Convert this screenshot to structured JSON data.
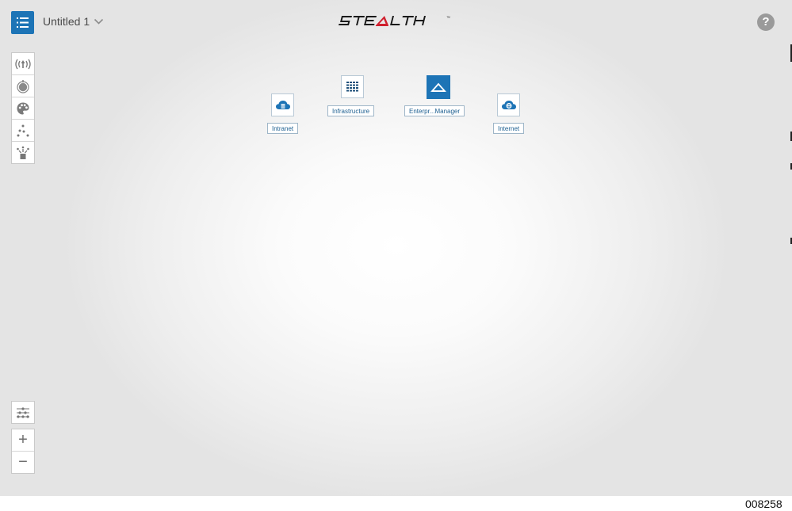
{
  "header": {
    "document_title": "Untitled 1",
    "brand_name": "STEALTH",
    "help_label": "?"
  },
  "left_toolbar": {
    "items": [
      {
        "icon": "broadcast-icon"
      },
      {
        "icon": "target-icon"
      },
      {
        "icon": "palette-icon"
      },
      {
        "icon": "scatter-dots-icon"
      },
      {
        "icon": "burst-icon"
      }
    ]
  },
  "view_controls": {
    "filter_icon": "sliders-icon",
    "zoom_in_label": "+",
    "zoom_out_label": "−"
  },
  "canvas": {
    "nodes": [
      {
        "label": "Intranet",
        "icon": "cloud-server-icon"
      },
      {
        "label": "Infrastructure",
        "icon": "grid-icon"
      },
      {
        "label": "Enterpr...Manager",
        "icon": "enterprise-manager-icon"
      },
      {
        "label": "Internet",
        "icon": "cloud-globe-icon"
      }
    ]
  },
  "colors": {
    "accent": "#1d74b6",
    "label_text": "#1d5f91",
    "brand_red": "#d0202e"
  },
  "footer": {
    "figure_number": "008258"
  }
}
